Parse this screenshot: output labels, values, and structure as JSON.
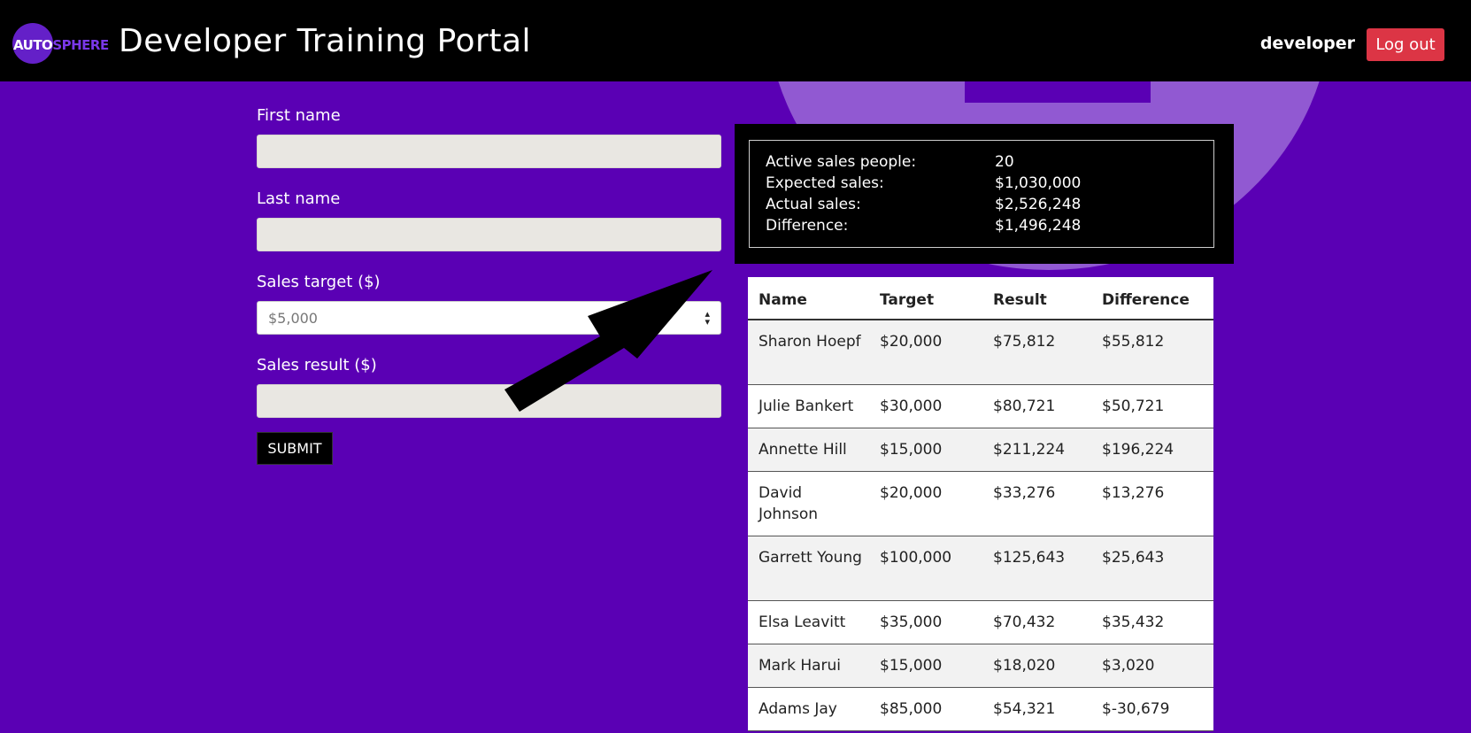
{
  "header": {
    "logo_part1": "AUTO",
    "logo_part2": "SPHERE",
    "title": "Developer Training Portal",
    "username": "developer",
    "logout_label": "Log out"
  },
  "form": {
    "first_name_label": "First name",
    "first_name_value": "",
    "last_name_label": "Last name",
    "last_name_value": "",
    "sales_target_label": "Sales target ($)",
    "sales_target_selected": "$5,000",
    "sales_result_label": "Sales result ($)",
    "sales_result_value": "",
    "submit_label": "SUBMIT"
  },
  "summary": {
    "rows": [
      {
        "label": "Active sales people:",
        "value": "20"
      },
      {
        "label": "Expected sales:",
        "value": "$1,030,000"
      },
      {
        "label": "Actual sales:",
        "value": "$2,526,248"
      },
      {
        "label": "Difference:",
        "value": "$1,496,248"
      }
    ]
  },
  "table": {
    "headers": [
      "Name",
      "Target",
      "Result",
      "Difference"
    ],
    "rows": [
      [
        "Sharon Hoepf",
        "$20,000",
        "$75,812",
        "$55,812"
      ],
      [
        "Julie Bankert",
        "$30,000",
        "$80,721",
        "$50,721"
      ],
      [
        "Annette Hill",
        "$15,000",
        "$211,224",
        "$196,224"
      ],
      [
        "David Johnson",
        "$20,000",
        "$33,276",
        "$13,276"
      ],
      [
        "Garrett Young",
        "$100,000",
        "$125,643",
        "$25,643"
      ],
      [
        "Elsa Leavitt",
        "$35,000",
        "$70,432",
        "$35,432"
      ],
      [
        "Mark Harui",
        "$15,000",
        "$18,020",
        "$3,020"
      ],
      [
        "Adams Jay",
        "$85,000",
        "$54,321",
        "$-30,679"
      ]
    ]
  },
  "colors": {
    "page_background": "#5a00b4",
    "header_background": "#000000",
    "logout_button": "#dc3545",
    "logo_accent": "#7a38e8"
  },
  "icons": {
    "select_arrow": "updown-caret-icon",
    "annotation_arrow": "arrow-icon"
  }
}
